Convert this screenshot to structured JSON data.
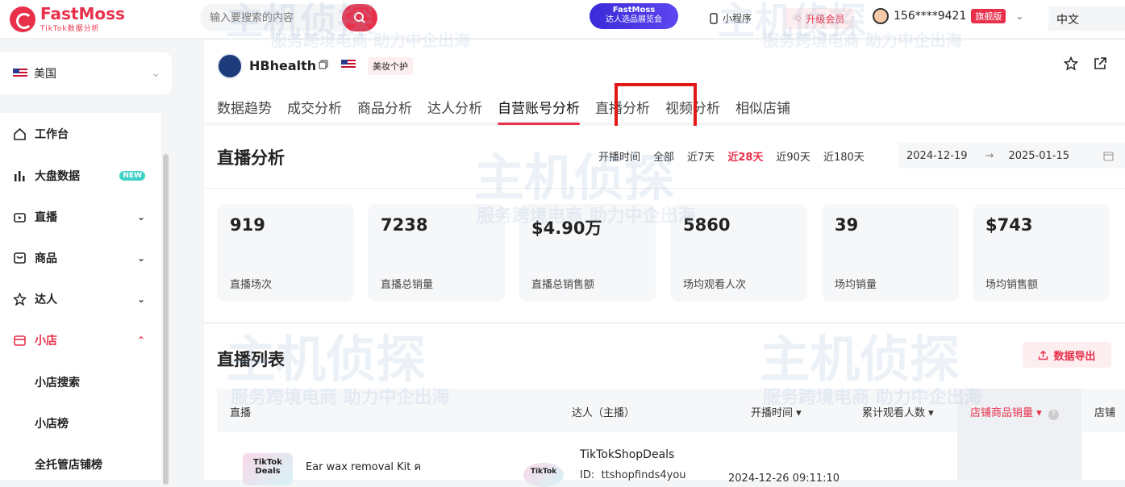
{
  "topbar": {
    "brand_name": "FastMoss",
    "brand_sub": "TikTok数据分析",
    "search_placeholder": "输入要搜索的内容",
    "promo_line1": "FastMoss",
    "promo_line2": "达人选品展览会",
    "mini_program": "小程序",
    "upgrade": "升级会员",
    "user_phone": "156****9421",
    "user_badge": "旗舰版",
    "language": "中文"
  },
  "sidebar": {
    "region": "美国",
    "items": [
      {
        "label": "工作台",
        "icon": "home-icon"
      },
      {
        "label": "大盘数据",
        "icon": "bar-chart-icon",
        "badge": "NEW"
      },
      {
        "label": "直播",
        "icon": "live-icon"
      },
      {
        "label": "商品",
        "icon": "product-icon"
      },
      {
        "label": "达人",
        "icon": "influencer-icon"
      },
      {
        "label": "小店",
        "icon": "shop-icon"
      }
    ],
    "sub_items": [
      "小店搜索",
      "小店榜",
      "全托管店铺榜"
    ]
  },
  "shop": {
    "name": "HBhealth",
    "category": "美妆个护",
    "tabs": [
      "数据趋势",
      "成交分析",
      "商品分析",
      "达人分析",
      "自营账号分析",
      "直播分析",
      "视频分析",
      "相似店铺"
    ],
    "active_tab": "自营账号分析"
  },
  "overview": {
    "title": "直播分析",
    "range_label": "开播时间",
    "ranges": [
      "全部",
      "近7天",
      "近28天",
      "近90天",
      "近180天"
    ],
    "active_range": "近28天",
    "start_date": "2024-12-19",
    "arrow": "→",
    "end_date": "2025-01-15",
    "stats": [
      {
        "value": "919",
        "label": "直播场次"
      },
      {
        "value": "7238",
        "label": "直播总销量"
      },
      {
        "value": "$4.90万",
        "label": "直播总销售额"
      },
      {
        "value": "5860",
        "label": "场均观看人次"
      },
      {
        "value": "39",
        "label": "场均销量"
      },
      {
        "value": "$743",
        "label": "场均销售额"
      }
    ]
  },
  "live_list": {
    "title": "直播列表",
    "export": "数据导出",
    "headers": [
      "直播",
      "达人（主播）",
      "开播时间",
      "累计观看人数",
      "店铺商品销量",
      "店铺"
    ],
    "row": {
      "thumb_text": "TikTok Deals",
      "title": "Ear wax removal Kit ฅ",
      "creator_name": "TikTokShopDeals",
      "creator_id_label": "ID:",
      "creator_id": "ttshopfinds4you",
      "start_time": "2024-12-26 09:11:10"
    }
  },
  "watermark": {
    "brand": "主机侦探",
    "slogan": "服务跨境电商 助力中企出海"
  }
}
